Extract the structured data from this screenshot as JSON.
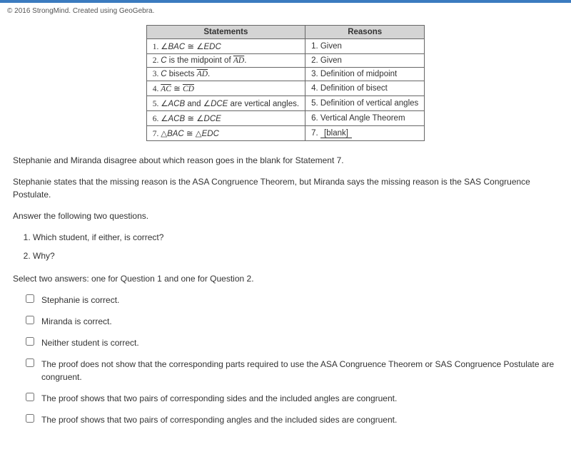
{
  "copyright": "© 2016 StrongMind. Created using GeoGebra.",
  "table": {
    "headers": {
      "statements": "Statements",
      "reasons": "Reasons"
    },
    "rows": [
      {
        "num": "1.",
        "statement_html": "∠<i>BAC</i> ≅ ∠<i>EDC</i>",
        "reason": "1. Given"
      },
      {
        "num": "2.",
        "statement_html": "<i>C</i> is the midpoint of <span class='overline'>AD</span>.",
        "reason": "2. Given"
      },
      {
        "num": "3.",
        "statement_html": "<i>C</i> bisects <span class='overline'>AD</span>.",
        "reason": "3. Definition of midpoint"
      },
      {
        "num": "4.",
        "statement_html": "<span class='overline'>AC</span> ≅ <span class='overline'>CD</span>",
        "reason": "4. Definition of bisect"
      },
      {
        "num": "5.",
        "statement_html": "∠<i>ACB</i> and ∠<i>DCE</i> are vertical angles.",
        "reason": "5. Definition of vertical angles"
      },
      {
        "num": "6.",
        "statement_html": "∠<i>ACB</i> ≅ ∠<i>DCE</i>",
        "reason": "6. Vertical Angle Theorem"
      },
      {
        "num": "7.",
        "statement_html": "△<i>BAC</i> ≅ △<i>EDC</i>",
        "reason": "7. __[blank]__"
      }
    ]
  },
  "body": {
    "p1": "Stephanie and Miranda disagree about which reason goes in the blank for Statement 7.",
    "p2": "Stephanie states that the missing reason is the ASA Congruence Theorem, but Miranda says the missing reason is the SAS Congruence Postulate.",
    "p3": "Answer the following two questions.",
    "q1": "Which student, if either, is correct?",
    "q2": "Why?",
    "p4": "Select two answers: one for Question 1 and one for Question 2."
  },
  "answers": [
    "Stephanie is correct.",
    "Miranda is correct.",
    "Neither student is correct.",
    "The proof does not show that the corresponding parts required to use the ASA Congruence Theorem or SAS Congruence Postulate are congruent.",
    "The proof shows that two pairs of corresponding sides and the included angles are congruent.",
    "The proof shows that two pairs of corresponding angles and the included sides are congruent."
  ]
}
